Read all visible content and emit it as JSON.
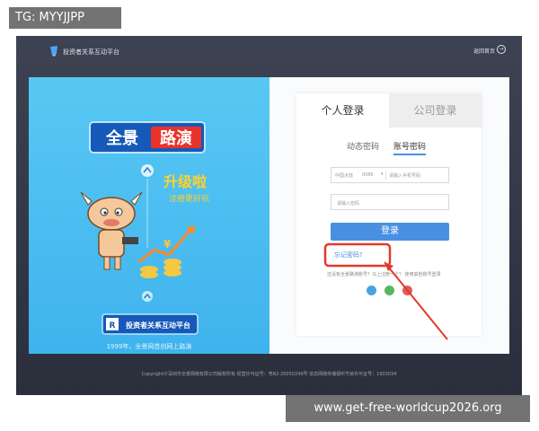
{
  "overlay": {
    "tag": "TG: MYYJJPP",
    "url": "www.get-free-worldcup2026.org"
  },
  "header": {
    "site_title": "投资者关系互动平台",
    "back_home": "返回首页",
    "back_icon": "arrow-right-circle-icon"
  },
  "hero": {
    "brand_badge_a": "全景",
    "brand_badge_b": "路演",
    "upgrade": "升级啦",
    "subtitle": "注册更好玩",
    "platform_label": "投资者关系互动平台",
    "tagline": "1999年，全景网首创网上路演"
  },
  "login": {
    "tabs": [
      "个人登录",
      "公司登录"
    ],
    "subtabs": [
      "动态密码",
      "账号密码"
    ],
    "active_subtab_index": 1,
    "country": "中国大陆",
    "country_code": "0086",
    "phone_placeholder": "请输入手机号码",
    "password_placeholder": "请输入密码",
    "submit_label": "登录",
    "forgot_label": "忘记密码?",
    "other_login_text": "还没有全景路演账号？马上注册一个？ 使用其他账号登录",
    "social_icons": [
      "qq-icon",
      "wechat-icon",
      "weibo-icon"
    ]
  },
  "footer": {
    "copyright": "Copyright©深圳市全景网络有限公司版权所有  经营许可证号：粤B2-20050249号  信息网络传播视听节目许可证号：1903034"
  },
  "colors": {
    "accent": "#4a90e2",
    "hero_bg": "#45b8f0",
    "frame_bg": "#373c4a",
    "highlight_red": "#e03a2b"
  }
}
